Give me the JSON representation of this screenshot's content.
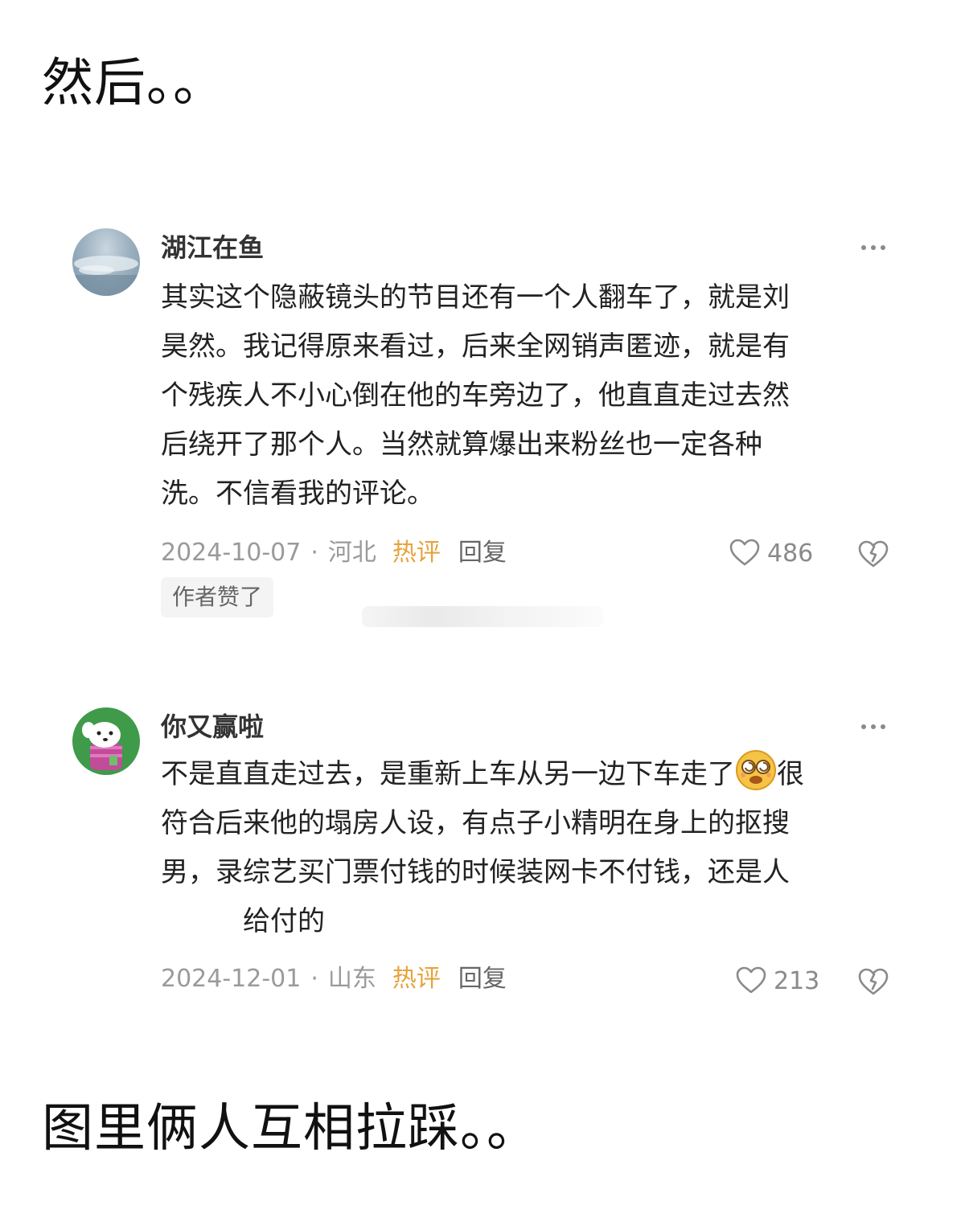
{
  "captions": {
    "top": "然后。。",
    "bottom": "图里俩人互相拉踩。。"
  },
  "colors": {
    "hot_tag": "#e6a33c",
    "meta_gray": "#9a9a9a"
  },
  "comments": [
    {
      "username": "湖江在鱼",
      "avatar_icon": "lake-landscape-avatar",
      "lines": [
        "其实这个隐蔽镜头的节目还有一个人翻车了，就是刘",
        "昊然。我记得原来看过，后来全网销声匿迹，就是有",
        "个残疾人不小心倒在他的车旁边了，他直直走过去然",
        "后绕开了那个人。当然就算爆出来粉丝也一定各种",
        "洗。不信看我的评论。"
      ],
      "date": "2024-10-07",
      "region": "河北",
      "hot_tag": "热评",
      "reply_label": "回复",
      "likes": "486",
      "author_liked": "作者赞了"
    },
    {
      "username": "你又赢啦",
      "avatar_icon": "dog-cartoon-avatar",
      "line1_before_emoji": "不是直直走过去，是重新上车从另一边下车走了",
      "emoji_icon": "dizzy-face-emoji",
      "line1_after_emoji": "很",
      "lines_rest": [
        "符合后来他的塌房人设，有点子小精明在身上的抠搜",
        "男，录综艺买门票付钱的时候装网卡不付钱，还是人",
        "　　　给付的"
      ],
      "date": "2024-12-01",
      "region": "山东",
      "hot_tag": "热评",
      "reply_label": "回复",
      "likes": "213"
    }
  ]
}
